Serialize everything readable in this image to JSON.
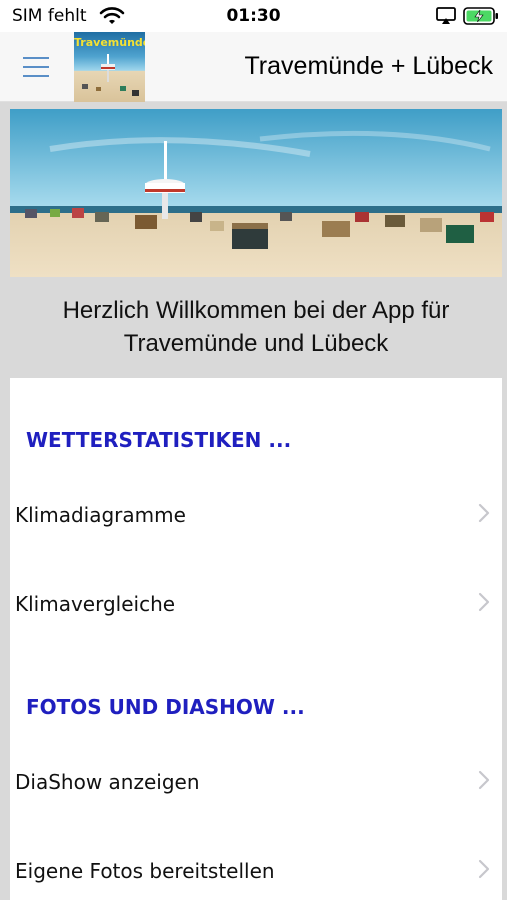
{
  "status_bar": {
    "carrier": "SIM fehlt",
    "time": "01:30"
  },
  "nav_bar": {
    "title": "Travemünde + Lübeck",
    "logo_text": "Travemünde"
  },
  "welcome": {
    "line1": "Herzlich Willkommen bei der App für",
    "line2": "Travemünde und Lübeck"
  },
  "sections": [
    {
      "header": "WETTERSTATISTIKEN ...",
      "items": [
        "Klimadiagramme",
        "Klimavergleiche"
      ]
    },
    {
      "header": "FOTOS UND DIASHOW ...",
      "items": [
        "DiaShow anzeigen",
        "Eigene Fotos bereitstellen"
      ]
    }
  ],
  "colors": {
    "section_header": "#1f1fbf",
    "menu_icon": "#5a8fc7",
    "battery_fill": "#4cd964",
    "background": "#d9d9d9"
  },
  "icons": {
    "menu": "hamburger-icon",
    "wifi": "wifi-icon",
    "airplay": "airplay-icon",
    "battery": "battery-charging-icon",
    "disclosure": "chevron-right-icon"
  }
}
